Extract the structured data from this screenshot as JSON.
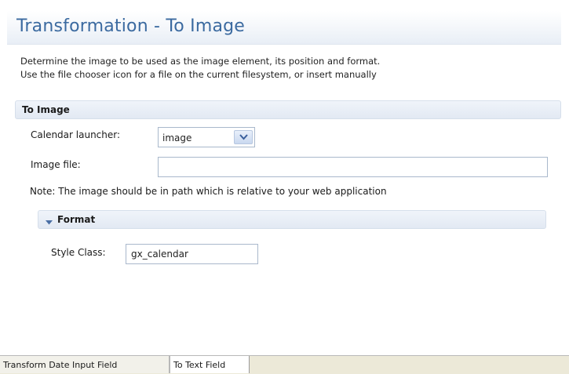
{
  "header": {
    "title": "Transformation - To Image"
  },
  "description": {
    "line1": "Determine the image to be used as the image element, its position and format.",
    "line2": "Use the file chooser icon for a file on the current filesystem, or insert manually"
  },
  "to_image_section": {
    "title": "To Image",
    "calendar_launcher": {
      "label": "Calendar launcher:",
      "value": "image"
    },
    "image_file": {
      "label": "Image file:",
      "value": ""
    },
    "note": "Note: The image should be in path which is relative to your web application"
  },
  "format_section": {
    "title": "Format",
    "style_class": {
      "label": "Style Class:",
      "value": "gx_calendar"
    }
  },
  "tabs": [
    {
      "label": "Transform Date Input Field"
    },
    {
      "label": "To Text Field"
    }
  ]
}
